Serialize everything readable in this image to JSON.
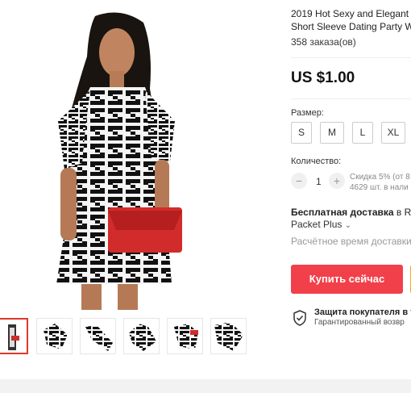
{
  "product": {
    "title_line1": "2019 Hot Sexy and Elegant f",
    "title_line2": "Short Sleeve Dating Party W",
    "orders": "358 заказа(ов)",
    "price": "US $1.00"
  },
  "size": {
    "label": "Размер:",
    "options": [
      "S",
      "M",
      "L",
      "XL"
    ]
  },
  "quantity": {
    "label": "Количество:",
    "value": "1",
    "minus": "−",
    "plus": "+",
    "discount_text": "Скидка 5% (от 8",
    "stock_text": "4629 шт. в нали"
  },
  "shipping": {
    "free_label": "Бесплатная доставка",
    "free_rest": " в R",
    "method": "Packet Plus",
    "method_chevron": "⌄",
    "estimate": "Расчётное время доставки"
  },
  "actions": {
    "buy_now": "Купить сейчас"
  },
  "protection": {
    "title": "Защита покупателя в т",
    "subtitle": "Гарантированный возвр"
  },
  "colors": {
    "accent": "#f2404a",
    "cart": "#f6a623"
  }
}
